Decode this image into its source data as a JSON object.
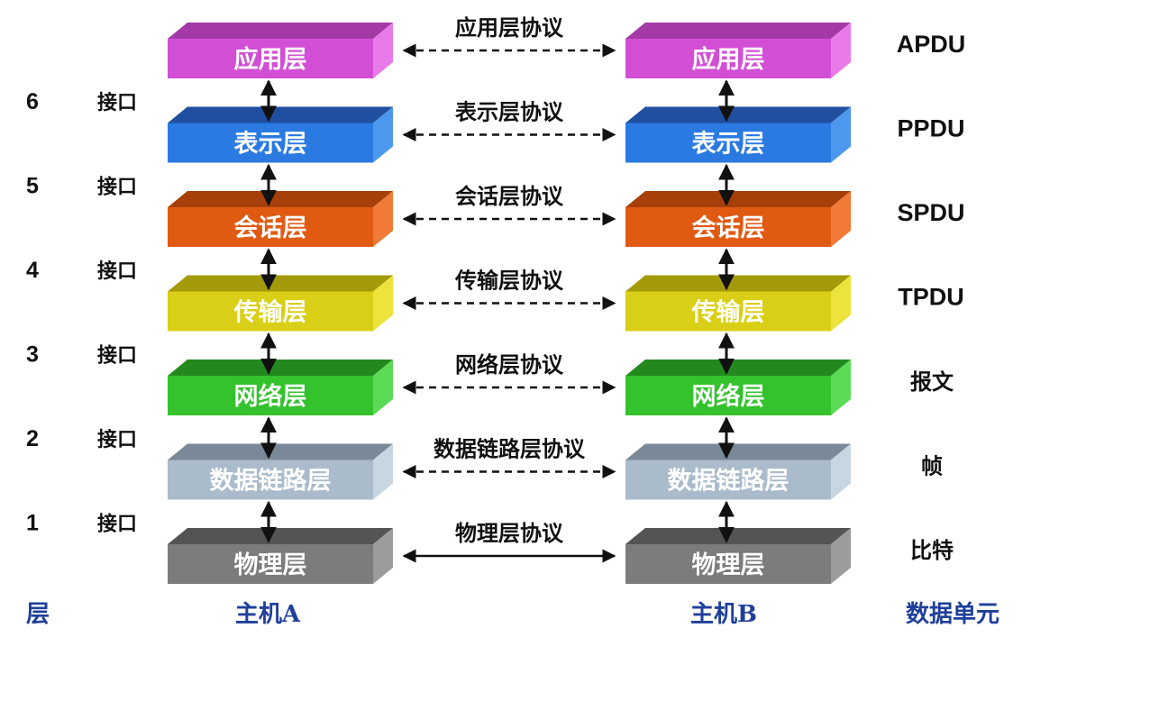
{
  "layers": [
    {
      "name": "应用层",
      "protocol": "应用层协议",
      "pdu": "APDU",
      "link": "dashed",
      "front": "#d24fd5",
      "top": "#a33aa6",
      "side": "#e87be9"
    },
    {
      "name": "表示层",
      "protocol": "表示层协议",
      "pdu": "PPDU",
      "link": "dashed",
      "front": "#2a7ae2",
      "top": "#1f4f9e",
      "side": "#4c98ee"
    },
    {
      "name": "会话层",
      "protocol": "会话层协议",
      "pdu": "SPDU",
      "link": "dashed",
      "front": "#e05a12",
      "top": "#a63f09",
      "side": "#f17a36"
    },
    {
      "name": "传输层",
      "protocol": "传输层协议",
      "pdu": "TPDU",
      "link": "dashed",
      "front": "#d9cf16",
      "top": "#a39a09",
      "side": "#ece33d"
    },
    {
      "name": "网络层",
      "protocol": "网络层协议",
      "pdu": "报文",
      "link": "dashed",
      "front": "#34c22d",
      "top": "#23891e",
      "side": "#5bdb55"
    },
    {
      "name": "数据链路层",
      "protocol": "数据链路层协议",
      "pdu": "帧",
      "link": "dashed",
      "front": "#aabbcc",
      "top": "#7a8998",
      "side": "#c8d6e2"
    },
    {
      "name": "物理层",
      "protocol": "物理层协议",
      "pdu": "比特",
      "link": "solid",
      "front": "#7c7c7c",
      "top": "#545454",
      "side": "#9c9c9c"
    }
  ],
  "interfaces": [
    {
      "number": "6",
      "label": "接口"
    },
    {
      "number": "5",
      "label": "接口"
    },
    {
      "number": "4",
      "label": "接口"
    },
    {
      "number": "3",
      "label": "接口"
    },
    {
      "number": "2",
      "label": "接口"
    },
    {
      "number": "1",
      "label": "接口"
    }
  ],
  "footer": {
    "layer_label": "层",
    "host_a": "主机A",
    "host_b": "主机B",
    "data_unit": "数据单元",
    "color": "#1f3f9a"
  }
}
